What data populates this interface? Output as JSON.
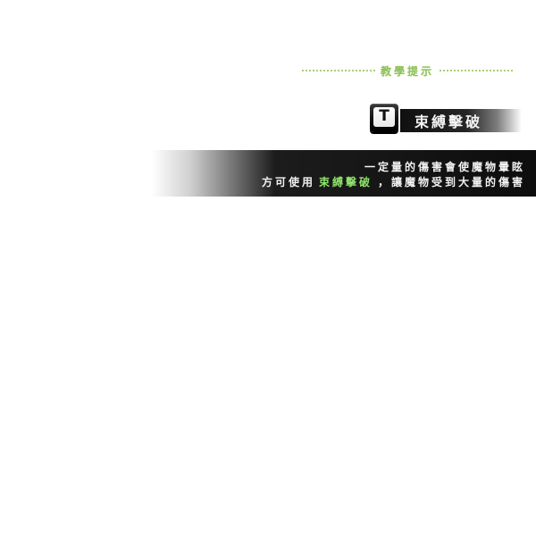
{
  "header": {
    "title": "教學提示"
  },
  "key": {
    "letter": "T",
    "icon": "keyboard-key-icon"
  },
  "skill": {
    "name": "束縛擊破"
  },
  "description": {
    "line1": "一定量的傷害會使魔物暈眩",
    "line2_prefix": "方可使用",
    "line2_highlight": "束縛擊破",
    "line2_suffix": "，讓魔物受到大量的傷害"
  },
  "colors": {
    "header_green": "#8fc05a",
    "highlight_green": "#8fe36a",
    "band_dark": "#0d0d0d",
    "text_light": "#f2f2f2"
  }
}
